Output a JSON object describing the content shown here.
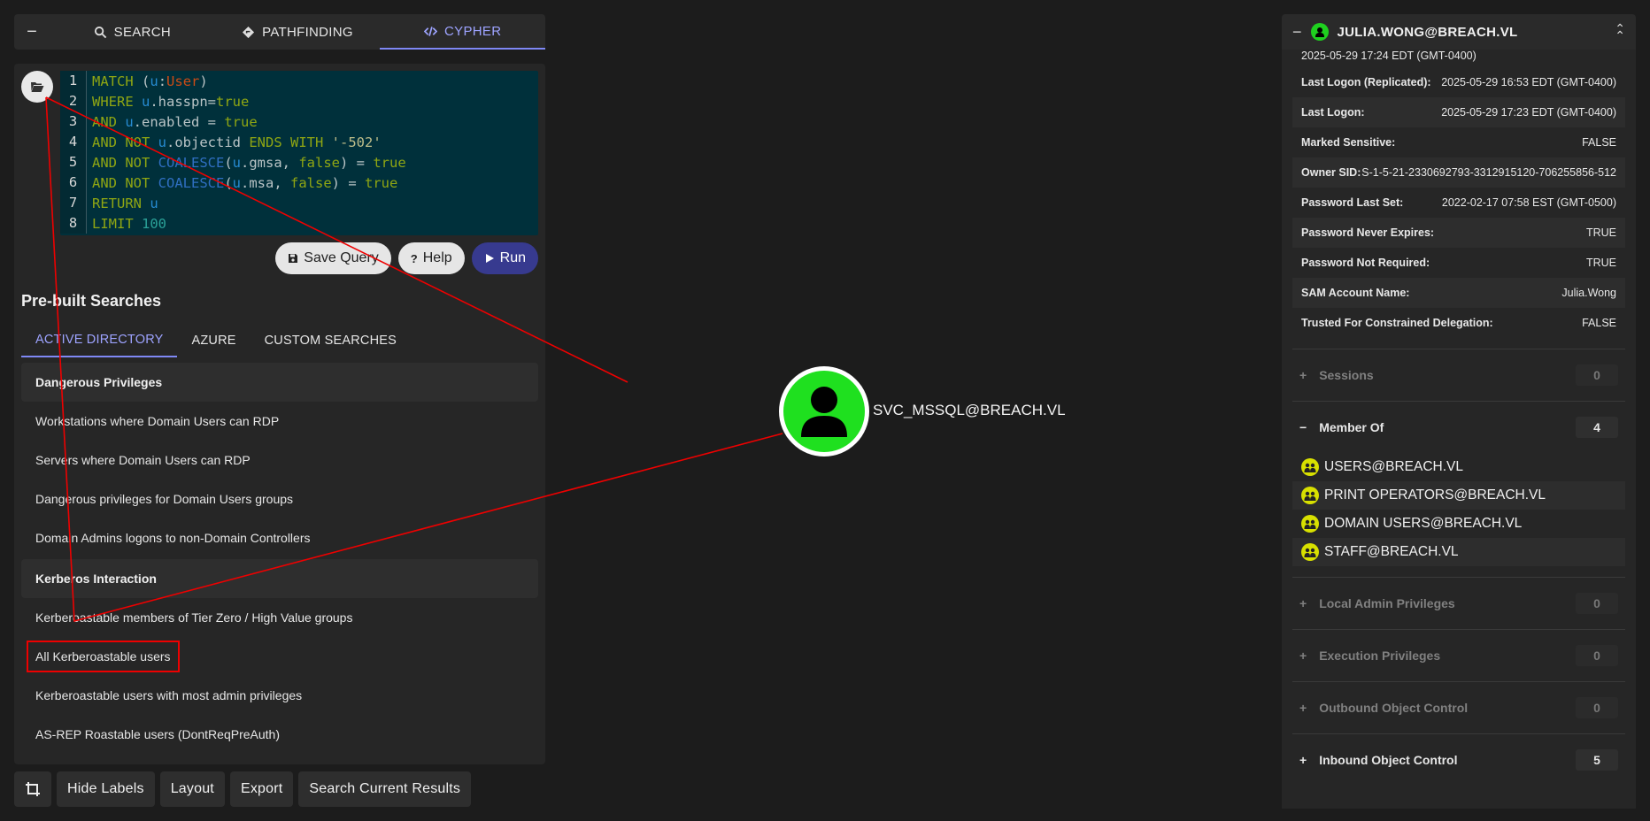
{
  "top_tabs": [
    "SEARCH",
    "PATHFINDING",
    "CYPHER"
  ],
  "code_lines": [
    {
      "n": "1",
      "parts": [
        {
          "c": "kw",
          "t": "MATCH "
        },
        {
          "c": "plain",
          "t": "("
        },
        {
          "c": "var",
          "t": "u"
        },
        {
          "c": "plain",
          "t": ":"
        },
        {
          "c": "lbl",
          "t": "User"
        },
        {
          "c": "plain",
          "t": ")"
        }
      ]
    },
    {
      "n": "2",
      "parts": [
        {
          "c": "kw",
          "t": "WHERE "
        },
        {
          "c": "var",
          "t": "u"
        },
        {
          "c": "plain",
          "t": ".hasspn="
        },
        {
          "c": "kw",
          "t": "true"
        }
      ]
    },
    {
      "n": "3",
      "parts": [
        {
          "c": "kw",
          "t": "AND "
        },
        {
          "c": "var",
          "t": "u"
        },
        {
          "c": "plain",
          "t": ".enabled = "
        },
        {
          "c": "kw",
          "t": "true"
        }
      ]
    },
    {
      "n": "4",
      "parts": [
        {
          "c": "kw",
          "t": "AND NOT "
        },
        {
          "c": "var",
          "t": "u"
        },
        {
          "c": "plain",
          "t": ".objectid "
        },
        {
          "c": "kw",
          "t": "ENDS WITH "
        },
        {
          "c": "str",
          "t": "'-502'"
        }
      ]
    },
    {
      "n": "5",
      "parts": [
        {
          "c": "kw",
          "t": "AND NOT "
        },
        {
          "c": "fn",
          "t": "COALESCE"
        },
        {
          "c": "plain",
          "t": "("
        },
        {
          "c": "var",
          "t": "u"
        },
        {
          "c": "plain",
          "t": ".gmsa, "
        },
        {
          "c": "kw",
          "t": "false"
        },
        {
          "c": "plain",
          "t": ") = "
        },
        {
          "c": "kw",
          "t": "true"
        }
      ]
    },
    {
      "n": "6",
      "parts": [
        {
          "c": "kw",
          "t": "AND NOT "
        },
        {
          "c": "fn",
          "t": "COALESCE"
        },
        {
          "c": "plain",
          "t": "("
        },
        {
          "c": "var",
          "t": "u"
        },
        {
          "c": "plain",
          "t": ".msa, "
        },
        {
          "c": "kw",
          "t": "false"
        },
        {
          "c": "plain",
          "t": ") = "
        },
        {
          "c": "kw",
          "t": "true"
        }
      ]
    },
    {
      "n": "7",
      "parts": [
        {
          "c": "kw",
          "t": "RETURN "
        },
        {
          "c": "var",
          "t": "u"
        }
      ]
    },
    {
      "n": "8",
      "parts": [
        {
          "c": "kw",
          "t": "LIMIT "
        },
        {
          "c": "num",
          "t": "100"
        }
      ]
    }
  ],
  "buttons": {
    "save": "Save Query",
    "help": "Help",
    "run": "Run"
  },
  "prebuilt_title": "Pre-built Searches",
  "sub_tabs": [
    "ACTIVE DIRECTORY",
    "AZURE",
    "CUSTOM SEARCHES"
  ],
  "groups": [
    {
      "header": "Dangerous Privileges",
      "items": [
        "Workstations where Domain Users can RDP",
        "Servers where Domain Users can RDP",
        "Dangerous privileges for Domain Users groups",
        "Domain Admins logons to non-Domain Controllers"
      ]
    },
    {
      "header": "Kerberos Interaction",
      "items": [
        "Kerberoastable members of Tier Zero / High Value groups",
        "All Kerberoastable users",
        "Kerberoastable users with most admin privileges",
        "AS-REP Roastable users (DontReqPreAuth)"
      ]
    }
  ],
  "bottom_buttons": [
    "Hide Labels",
    "Layout",
    "Export",
    "Search Current Results"
  ],
  "node_label": "SVC_MSSQL@BREACH.VL",
  "entity": {
    "title": "JULIA.WONG@BREACH.VL",
    "top_partial": "2025-05-29 17:24 EDT (GMT-0400)",
    "properties": [
      {
        "k": "Last Logon (Replicated):",
        "v": "2025-05-29 16:53 EDT (GMT-0400)"
      },
      {
        "k": "Last Logon:",
        "v": "2025-05-29 17:23 EDT (GMT-0400)"
      },
      {
        "k": "Marked Sensitive:",
        "v": "FALSE"
      },
      {
        "k": "Owner SID:",
        "v": "S-1-5-21-2330692793-3312915120-706255856-512"
      },
      {
        "k": "Password Last Set:",
        "v": "2022-02-17 07:58 EST (GMT-0500)"
      },
      {
        "k": "Password Never Expires:",
        "v": "TRUE"
      },
      {
        "k": "Password Not Required:",
        "v": "TRUE"
      },
      {
        "k": "SAM Account Name:",
        "v": "Julia.Wong"
      },
      {
        "k": "Trusted For Constrained Delegation:",
        "v": "FALSE"
      }
    ],
    "sessions": {
      "label": "Sessions",
      "count": "0"
    },
    "member_of": {
      "label": "Member Of",
      "count": "4",
      "items": [
        "USERS@BREACH.VL",
        "PRINT OPERATORS@BREACH.VL",
        "DOMAIN USERS@BREACH.VL",
        "STAFF@BREACH.VL"
      ]
    },
    "sections": [
      {
        "label": "Local Admin Privileges",
        "count": "0",
        "dim": true
      },
      {
        "label": "Execution Privileges",
        "count": "0",
        "dim": true
      },
      {
        "label": "Outbound Object Control",
        "count": "0",
        "dim": true
      },
      {
        "label": "Inbound Object Control",
        "count": "5",
        "dim": false
      }
    ]
  },
  "colors": {
    "accent": "#9da3ff",
    "node": "#1fe01f",
    "annotation": "#e00000",
    "run": "#373a8f"
  }
}
